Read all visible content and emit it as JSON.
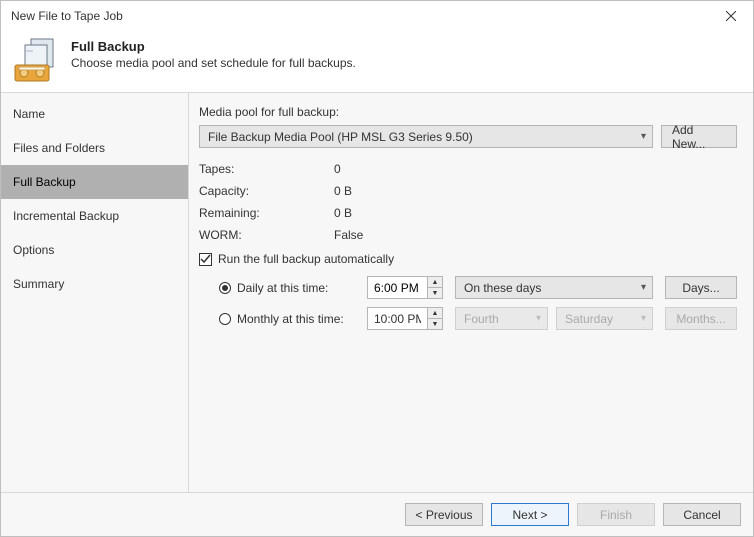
{
  "window": {
    "title": "New File to Tape Job"
  },
  "header": {
    "heading": "Full Backup",
    "sub": "Choose media pool and set schedule for full backups."
  },
  "sidebar": {
    "items": [
      {
        "label": "Name"
      },
      {
        "label": "Files and Folders"
      },
      {
        "label": "Full Backup"
      },
      {
        "label": "Incremental Backup"
      },
      {
        "label": "Options"
      },
      {
        "label": "Summary"
      }
    ]
  },
  "main": {
    "mediaPoolLabel": "Media pool for full backup:",
    "mediaPoolSelected": "File Backup Media Pool (HP MSL G3 Series 9.50)",
    "addNewLabel": "Add New...",
    "stats": {
      "tapes": {
        "k": "Tapes:",
        "v": "0"
      },
      "capacity": {
        "k": "Capacity:",
        "v": "0 B"
      },
      "remaining": {
        "k": "Remaining:",
        "v": "0 B"
      },
      "worm": {
        "k": "WORM:",
        "v": "False"
      }
    },
    "autoCheckboxLabel": "Run the full backup automatically",
    "schedule": {
      "daily": {
        "label": "Daily at this time:",
        "time": "6:00 PM",
        "option": "On these days",
        "button": "Days..."
      },
      "monthly": {
        "label": "Monthly at this time:",
        "time": "10:00 PM",
        "opt1": "Fourth",
        "opt2": "Saturday",
        "button": "Months..."
      }
    }
  },
  "footer": {
    "previous": "< Previous",
    "next": "Next >",
    "finish": "Finish",
    "cancel": "Cancel"
  }
}
